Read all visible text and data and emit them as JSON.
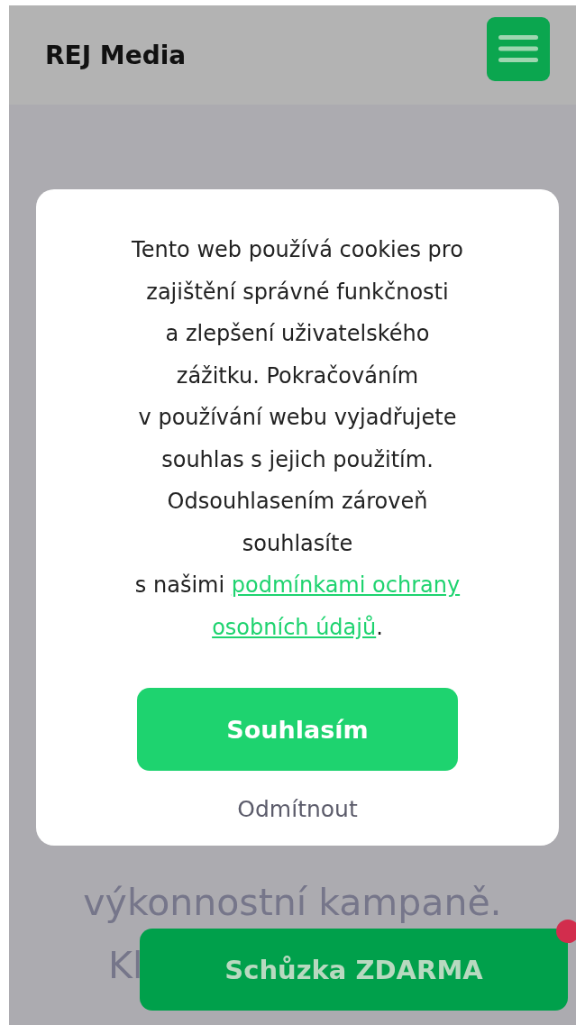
{
  "header": {
    "brand": "REJ Media"
  },
  "background_text": [
    "výkonnostní kampaně.",
    "Kl"
  ],
  "cookie_dialog": {
    "message_lines": [
      "Tento web používá cookies pro",
      "zajištění správné funkčnosti",
      "a zlepšení uživatelského",
      "zážitku. Pokračováním",
      "v používání webu vyjadřujete",
      "souhlas s jejich použitím.",
      "Odsouhlasením zároveň",
      "souhlasíte"
    ],
    "link_prefix": "s našimi ",
    "link_text": [
      "podmínkami ochrany",
      "osobních údajů"
    ],
    "link_suffix": ".",
    "accept_button": "Souhlasím",
    "decline_button": "Odmítnout"
  },
  "floating_button": {
    "label": "Schůzka ZDARMA",
    "notification_dot": true
  }
}
